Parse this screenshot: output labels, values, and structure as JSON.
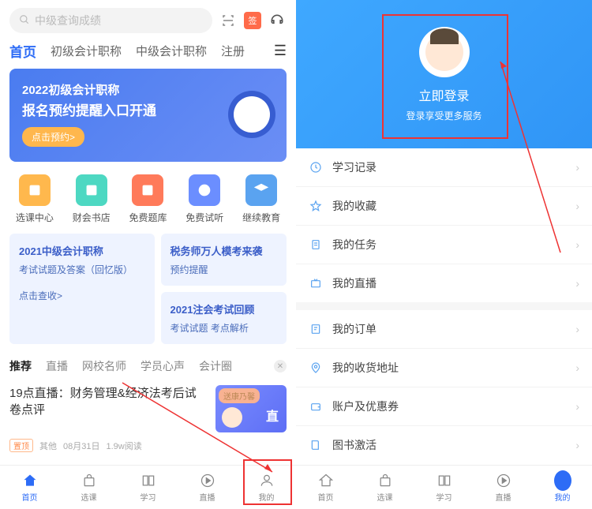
{
  "left": {
    "search_placeholder": "中级查询成绩",
    "tabs": [
      "首页",
      "初级会计职称",
      "中级会计职称",
      "注册"
    ],
    "banner": {
      "title": "2022初级会计职称",
      "subtitle": "报名预约提醒入口开通",
      "button": "点击预约>"
    },
    "quick": [
      {
        "label": "选课中心",
        "color": "#ffb84d"
      },
      {
        "label": "财会书店",
        "color": "#4dd8c2"
      },
      {
        "label": "免费题库",
        "color": "#ff7a5a"
      },
      {
        "label": "免费试听",
        "color": "#6b8eff"
      },
      {
        "label": "继续教育",
        "color": "#5aa3f0"
      }
    ],
    "cards": {
      "left": {
        "title": "2021中级会计职称",
        "line1": "考试试题及答案（回忆版）",
        "line2": "点击查收>"
      },
      "right_top": {
        "title": "税务师万人模考来袭",
        "line1": "预约提醒"
      },
      "right_bottom": {
        "title": "2021注会考试回顾",
        "line1": "考试试题 考点解析"
      }
    },
    "subtabs": [
      "推荐",
      "直播",
      "网校名师",
      "学员心声",
      "会计圈"
    ],
    "article": {
      "title": "19点直播：财务管理&经济法考后试卷点评",
      "badge": "送康乃馨",
      "thumb_text": "直",
      "tag": "置顶",
      "source": "其他",
      "date": "08月31日",
      "views": "1.9w阅读"
    },
    "nav": [
      "首页",
      "选课",
      "学习",
      "直播",
      "我的"
    ]
  },
  "right": {
    "login": "立即登录",
    "login_sub": "登录享受更多服务",
    "menu": [
      {
        "label": "学习记录",
        "icon": "clock-icon"
      },
      {
        "label": "我的收藏",
        "icon": "star-icon"
      },
      {
        "label": "我的任务",
        "icon": "clipboard-icon"
      },
      {
        "label": "我的直播",
        "icon": "tv-icon"
      }
    ],
    "menu2": [
      {
        "label": "我的订单",
        "icon": "order-icon"
      },
      {
        "label": "我的收货地址",
        "icon": "location-icon"
      },
      {
        "label": "账户及优惠券",
        "icon": "wallet-icon"
      },
      {
        "label": "图书激活",
        "icon": "book-icon"
      }
    ],
    "nav": [
      "首页",
      "选课",
      "学习",
      "直播",
      "我的"
    ]
  }
}
